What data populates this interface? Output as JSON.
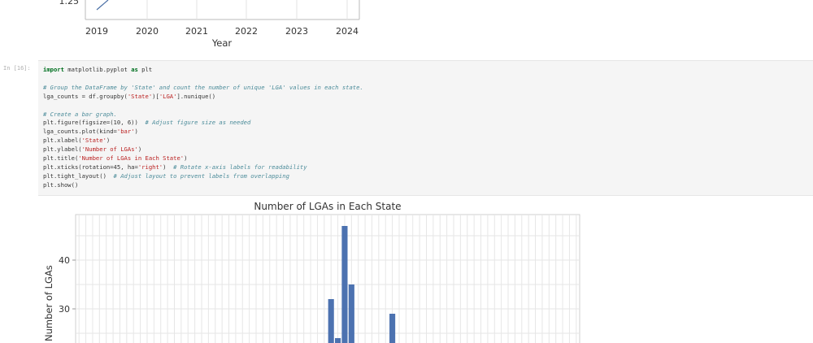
{
  "previous_chart": {
    "visible_ytick": "1.25",
    "xticks": [
      "2019",
      "2020",
      "2021",
      "2022",
      "2023",
      "2024"
    ],
    "xlabel": "Year",
    "line_color": "#4a6fa5"
  },
  "cell": {
    "prompt": "In [16]:",
    "code_lines": [
      [
        {
          "t": "import",
          "c": "kw"
        },
        {
          "t": " matplotlib.pyplot ",
          "c": ""
        },
        {
          "t": "as",
          "c": "kw"
        },
        {
          "t": " plt",
          "c": ""
        }
      ],
      [],
      [
        {
          "t": "# Group the DataFrame by 'State' and count the number of unique 'LGA' values in each state.",
          "c": "cm"
        }
      ],
      [
        {
          "t": "lga_counts = df.groupby(",
          "c": ""
        },
        {
          "t": "'State'",
          "c": "st"
        },
        {
          "t": ")[",
          "c": ""
        },
        {
          "t": "'LGA'",
          "c": "st"
        },
        {
          "t": "].nunique()",
          "c": ""
        }
      ],
      [],
      [
        {
          "t": "# Create a bar graph.",
          "c": "cm"
        }
      ],
      [
        {
          "t": "plt.figure(figsize=(10, 6))  ",
          "c": ""
        },
        {
          "t": "# Adjust figure size as needed",
          "c": "cm"
        }
      ],
      [
        {
          "t": "lga_counts.plot(kind=",
          "c": ""
        },
        {
          "t": "'bar'",
          "c": "st"
        },
        {
          "t": ")",
          "c": ""
        }
      ],
      [
        {
          "t": "plt.xlabel(",
          "c": ""
        },
        {
          "t": "'State'",
          "c": "st"
        },
        {
          "t": ")",
          "c": ""
        }
      ],
      [
        {
          "t": "plt.ylabel(",
          "c": ""
        },
        {
          "t": "'Number of LGAs'",
          "c": "st"
        },
        {
          "t": ")",
          "c": ""
        }
      ],
      [
        {
          "t": "plt.title(",
          "c": ""
        },
        {
          "t": "'Number of LGAs in Each State'",
          "c": "st"
        },
        {
          "t": ")",
          "c": ""
        }
      ],
      [
        {
          "t": "plt.xticks(rotation=45, ha=",
          "c": ""
        },
        {
          "t": "'right'",
          "c": "st"
        },
        {
          "t": ")  ",
          "c": ""
        },
        {
          "t": "# Rotate x-axis labels for readability",
          "c": "cm"
        }
      ],
      [
        {
          "t": "plt.tight_layout()  ",
          "c": ""
        },
        {
          "t": "# Adjust layout to prevent labels from overlapping",
          "c": "cm"
        }
      ],
      [
        {
          "t": "plt.show()",
          "c": ""
        }
      ]
    ]
  },
  "chart_data": {
    "type": "bar",
    "title": "Number of LGAs in Each State",
    "ylabel": "Number of LGAs",
    "xlabel": "",
    "ylim": [
      0,
      50
    ],
    "yticks": [
      30,
      40
    ],
    "grid": true,
    "bar_color": "#4c72b0",
    "values": [
      null,
      null,
      null,
      null,
      null,
      null,
      null,
      null,
      null,
      null,
      null,
      null,
      null,
      null,
      null,
      null,
      null,
      null,
      null,
      null,
      null,
      null,
      null,
      null,
      null,
      null,
      null,
      null,
      null,
      null,
      null,
      null,
      null,
      null,
      null,
      null,
      null,
      32,
      24,
      47,
      35,
      null,
      null,
      null,
      null,
      null,
      29,
      null,
      null,
      null,
      null,
      null,
      null,
      null,
      null,
      null,
      null,
      null,
      null,
      null,
      null,
      null,
      null,
      null,
      null,
      null,
      null,
      null,
      null,
      null,
      null,
      null,
      null,
      null
    ]
  }
}
